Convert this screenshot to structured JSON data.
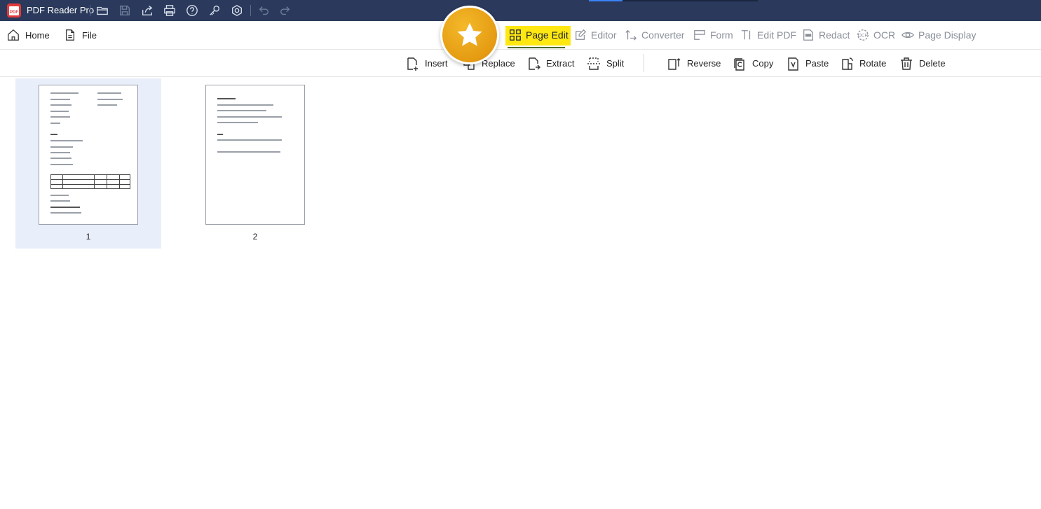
{
  "app": {
    "title": "PDF Reader Pro",
    "accent_color": "#2b3a5c"
  },
  "titlebar_icons": [
    "open-folder-icon",
    "save-icon",
    "share-icon",
    "print-icon",
    "help-icon",
    "key-icon",
    "settings-icon",
    "undo-icon",
    "redo-icon"
  ],
  "nav": {
    "home": "Home",
    "file": "File"
  },
  "modes": {
    "page_edit": "Page Edit",
    "editor": "Editor",
    "converter": "Converter",
    "form": "Form",
    "edit_pdf": "Edit PDF",
    "redact": "Redact",
    "ocr": "OCR",
    "page_display": "Page Display",
    "highlight_color": "#ffe812"
  },
  "toolbar": {
    "insert": "Insert",
    "replace": "Replace",
    "extract": "Extract",
    "split": "Split",
    "reverse": "Reverse",
    "copy": "Copy",
    "paste": "Paste",
    "rotate": "Rotate",
    "delete": "Delete"
  },
  "pages": [
    {
      "number": "1",
      "selected": true
    },
    {
      "number": "2",
      "selected": false
    }
  ],
  "badge_icon": "star-icon"
}
